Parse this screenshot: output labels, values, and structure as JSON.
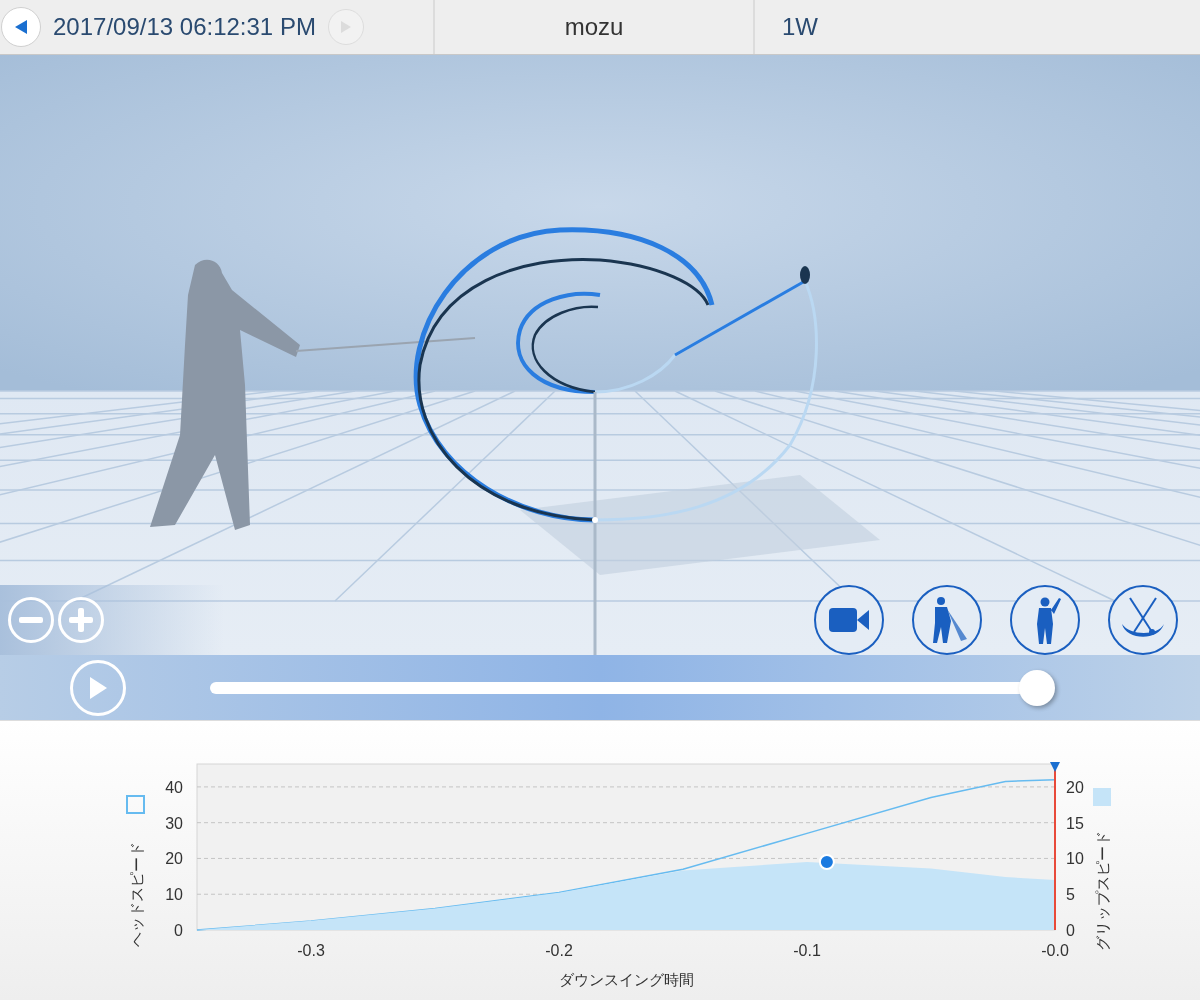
{
  "header": {
    "datetime": "2017/09/13 06:12:31 PM",
    "prev_disabled": false,
    "next_disabled": true,
    "player": "mozu",
    "club": "1W"
  },
  "playback": {
    "level": 0.98
  },
  "chart": {
    "chart_data": {
      "type": "line",
      "grid": true,
      "xlabel": "ダウンスイング時間",
      "ylabel": "ヘッドスピード",
      "y2label": "グリップスピード",
      "x": [
        -0.346,
        -0.3,
        -0.25,
        -0.2,
        -0.15,
        -0.1,
        -0.05,
        -0.02,
        0
      ],
      "xlim": [
        -0.346,
        0
      ],
      "ylim": [
        0,
        46.4
      ],
      "y2lim": [
        0,
        23.2
      ],
      "xticks": [
        {
          "value": -0.3,
          "label": "-0.3"
        },
        {
          "value": -0.2,
          "label": "-0.2"
        },
        {
          "value": -0.1,
          "label": "-0.1"
        },
        {
          "value": 0,
          "label": "-0.0"
        }
      ],
      "yticks": [
        0,
        10,
        20,
        30,
        40
      ],
      "y2ticks": [
        0,
        5,
        10,
        15,
        20
      ],
      "series": [
        {
          "color": "#66bbf0",
          "values": [
            0,
            2.5,
            6,
            10.5,
            17,
            27,
            37,
            41.5,
            42
          ]
        },
        {
          "type": "area",
          "axis": "y2",
          "color": "#c5e4f8",
          "values": [
            0,
            1.3,
            3,
            5.2,
            8.3,
            9.5,
            8.6,
            7.4,
            7
          ]
        }
      ]
    }
  }
}
